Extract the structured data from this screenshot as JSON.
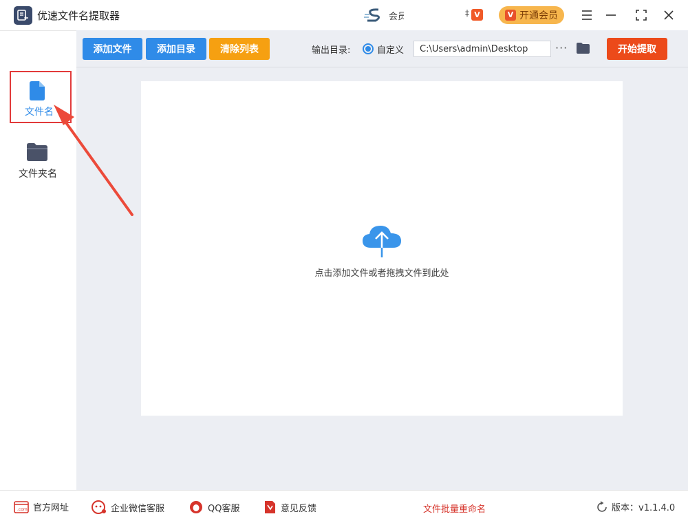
{
  "app": {
    "title": "优速文件名提取器"
  },
  "titlebar": {
    "ad_text": "会员",
    "ad_small": "‡",
    "ad_badge": "V",
    "vip_icon": "V",
    "vip_label": "开通会员"
  },
  "sidebar": {
    "items": [
      {
        "label": "文件名",
        "icon": "file-icon",
        "active": true
      },
      {
        "label": "文件夹名",
        "icon": "folder-icon",
        "active": false
      }
    ]
  },
  "toolbar": {
    "add_file": "添加文件",
    "add_dir": "添加目录",
    "clear_list": "清除列表",
    "output_label": "输出目录:",
    "custom_label": "自定义",
    "output_path": "C:\\Users\\admin\\Desktop",
    "more": "···",
    "start": "开始提取"
  },
  "dropzone": {
    "hint": "点击添加文件或者拖拽文件到此处"
  },
  "footer": {
    "website": "官方网址",
    "wechat": "企业微信客服",
    "qq": "QQ客服",
    "feedback": "意见反馈",
    "center_link": "文件批量重命名",
    "version": "版本：v1.1.4.0"
  },
  "colors": {
    "primary": "#2f8be8",
    "orange": "#f6a011",
    "red": "#ec4a1a",
    "highlight": "#e23a3a",
    "vip": "#f7b64d"
  }
}
